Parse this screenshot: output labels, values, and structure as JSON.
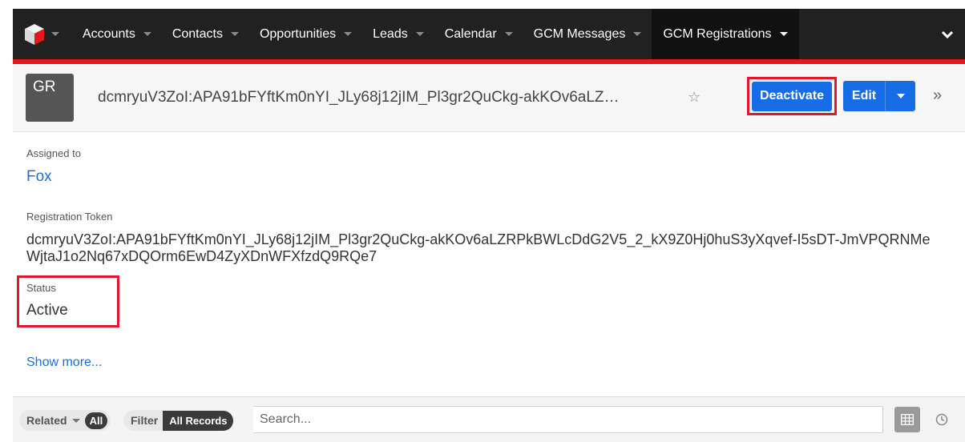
{
  "nav": {
    "items": [
      {
        "label": "Accounts"
      },
      {
        "label": "Contacts"
      },
      {
        "label": "Opportunities"
      },
      {
        "label": "Leads"
      },
      {
        "label": "Calendar"
      },
      {
        "label": "GCM Messages"
      }
    ],
    "active_item": "GCM Registrations",
    "accent_color": "#e61718"
  },
  "record": {
    "badge": "GR",
    "title": "dcmryuV3ZoI:APA91bFYftKm0nYI_JLy68j12jIM_Pl3gr2QuCkg-akKOv6aLZ…",
    "star_icon": "☆",
    "deactivate_label": "Deactivate",
    "edit_label": "Edit",
    "more_icon": "»"
  },
  "fields": {
    "assigned_label": "Assigned to",
    "assigned_value": "Fox",
    "token_label": "Registration Token",
    "token_value": "dcmryuV3ZoI:APA91bFYftKm0nYI_JLy68j12jIM_Pl3gr2QuCkg-akKOv6aLZRPkBWLcDdG2V5_2_kX9Z0Hj0huS3yXqvef-I5sDT-JmVPQRNMeWjtaJ1o2Nq67xDQOrm6EwD4ZyXDnWFXfzdQ9RQe7",
    "status_label": "Status",
    "status_value": "Active",
    "show_more": "Show more..."
  },
  "bottom": {
    "related_label": "Related",
    "related_tag": "All",
    "filter_label": "Filter",
    "filter_tag": "All Records",
    "search_placeholder": "Search..."
  },
  "colors": {
    "primary_button": "#176de5",
    "highlight_box": "#e0182d",
    "link": "#1a6fd8"
  }
}
